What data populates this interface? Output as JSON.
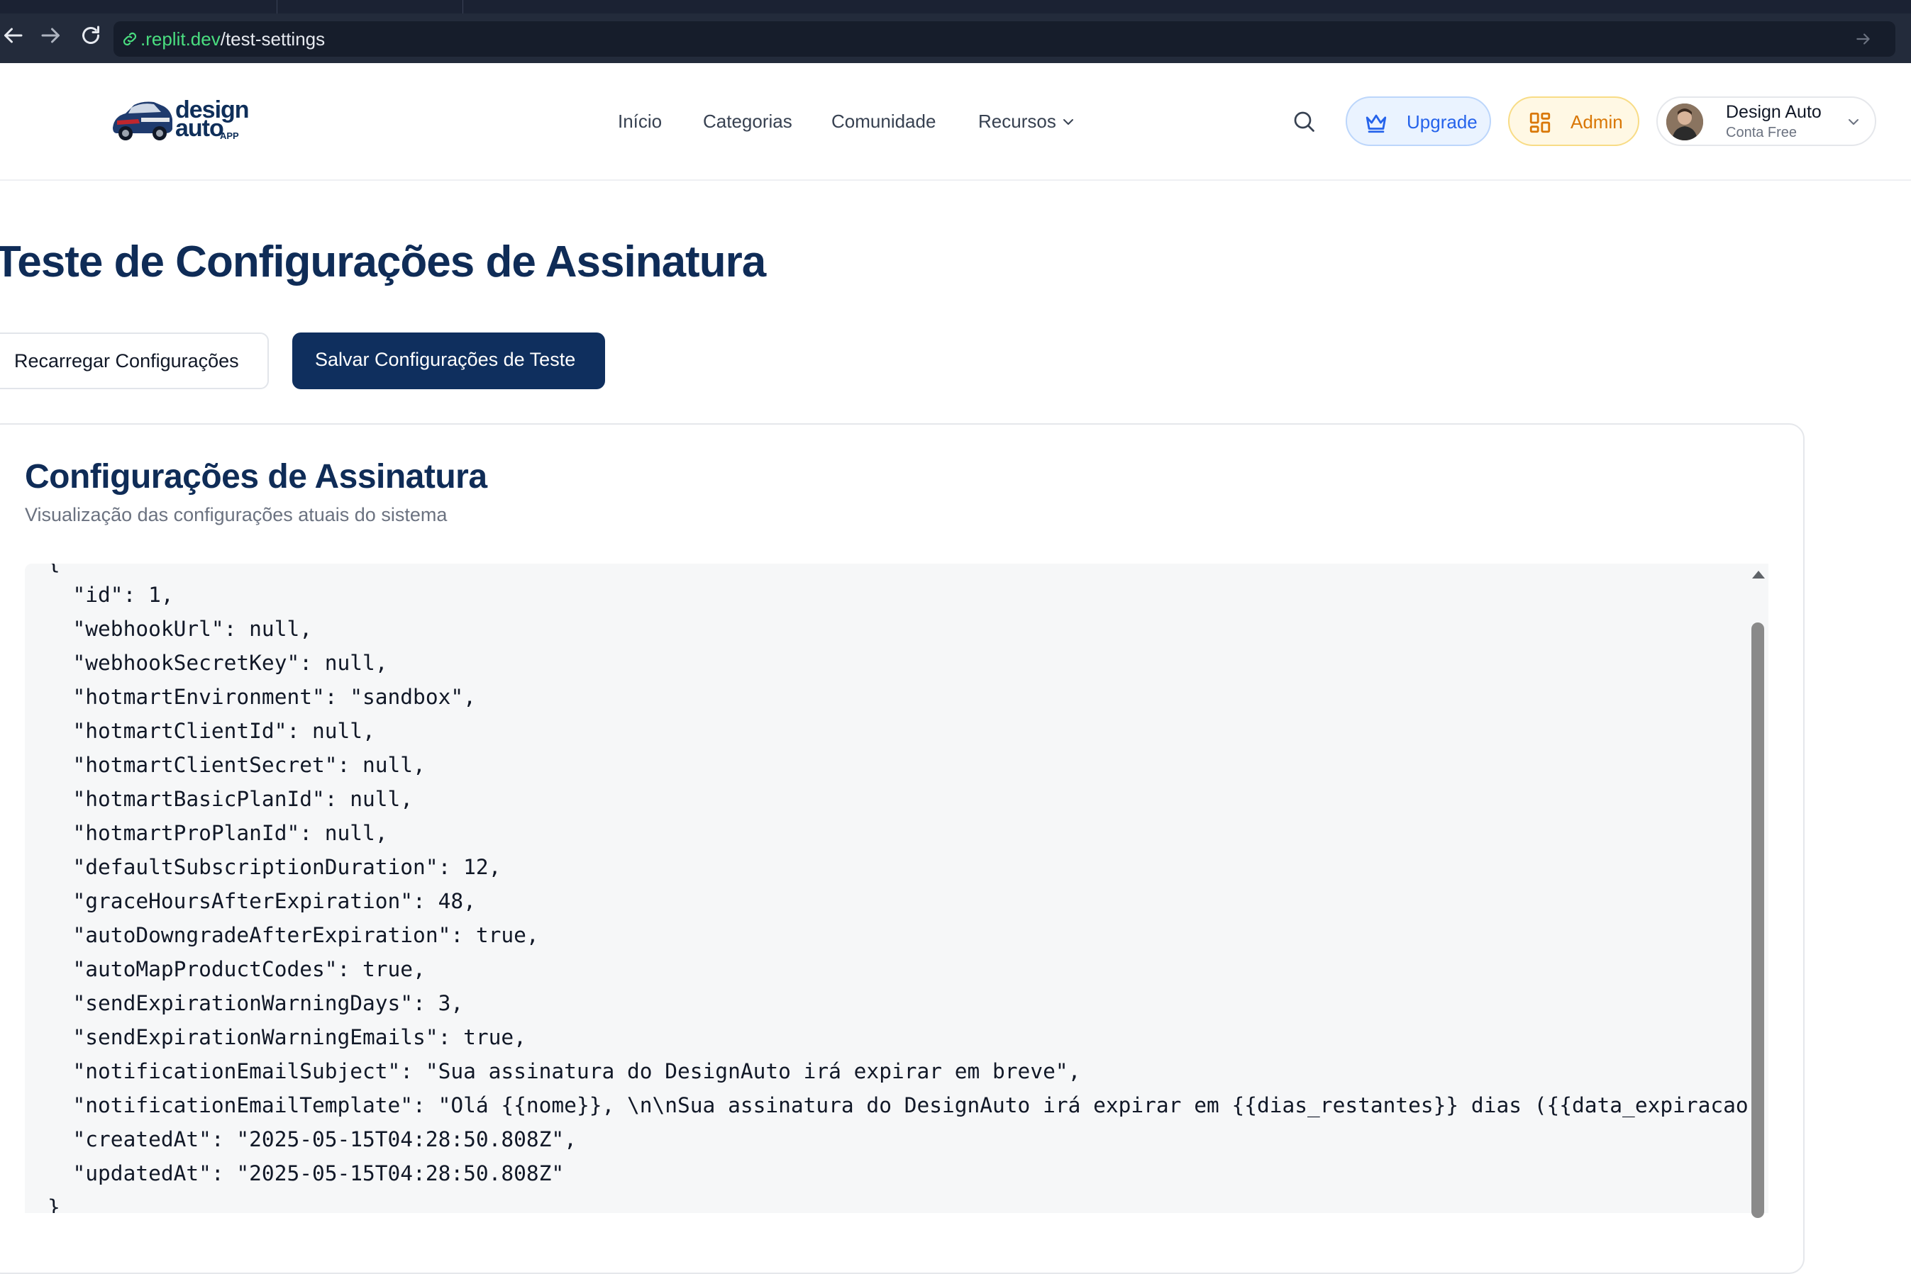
{
  "browser": {
    "url_domain": ".replit.dev",
    "url_path": "/test-settings"
  },
  "header": {
    "logo": {
      "line1": "design",
      "line2": "auto",
      "line3": "APP"
    },
    "nav": [
      "Início",
      "Categorias",
      "Comunidade",
      "Recursos"
    ],
    "upgrade_label": "Upgrade",
    "admin_label": "Admin",
    "user": {
      "name": "Design Auto",
      "plan": "Conta Free"
    }
  },
  "page": {
    "title": "Teste de Configurações de Assinatura",
    "reload_label": "Recarregar Configurações",
    "save_label": "Salvar Configurações de Teste"
  },
  "card": {
    "title": "Configurações de Assinatura",
    "subtitle": "Visualização das configurações atuais do sistema"
  },
  "json_lines": [
    "{",
    "  \"id\": 1,",
    "  \"webhookUrl\": null,",
    "  \"webhookSecretKey\": null,",
    "  \"hotmartEnvironment\": \"sandbox\",",
    "  \"hotmartClientId\": null,",
    "  \"hotmartClientSecret\": null,",
    "  \"hotmartBasicPlanId\": null,",
    "  \"hotmartProPlanId\": null,",
    "  \"defaultSubscriptionDuration\": 12,",
    "  \"graceHoursAfterExpiration\": 48,",
    "  \"autoDowngradeAfterExpiration\": true,",
    "  \"autoMapProductCodes\": true,",
    "  \"sendExpirationWarningDays\": 3,",
    "  \"sendExpirationWarningEmails\": true,",
    "  \"notificationEmailSubject\": \"Sua assinatura do DesignAuto irá expirar em breve\",",
    "  \"notificationEmailTemplate\": \"Olá {{nome}}, \\n\\nSua assinatura do DesignAuto irá expirar em {{dias_restantes}} dias ({{data_expiracao}}).",
    "  \"createdAt\": \"2025-05-15T04:28:50.808Z\",",
    "  \"updatedAt\": \"2025-05-15T04:28:50.808Z\"",
    "}"
  ],
  "colors": {
    "brand_navy": "#0f2f5e",
    "upgrade_blue": "#2563eb",
    "admin_amber": "#d97706",
    "url_green": "#4ade80"
  },
  "icons": [
    "back-icon",
    "forward-icon",
    "reload-icon",
    "link-icon",
    "search-icon",
    "crown-icon",
    "grid-icon",
    "chevron-down-icon"
  ]
}
